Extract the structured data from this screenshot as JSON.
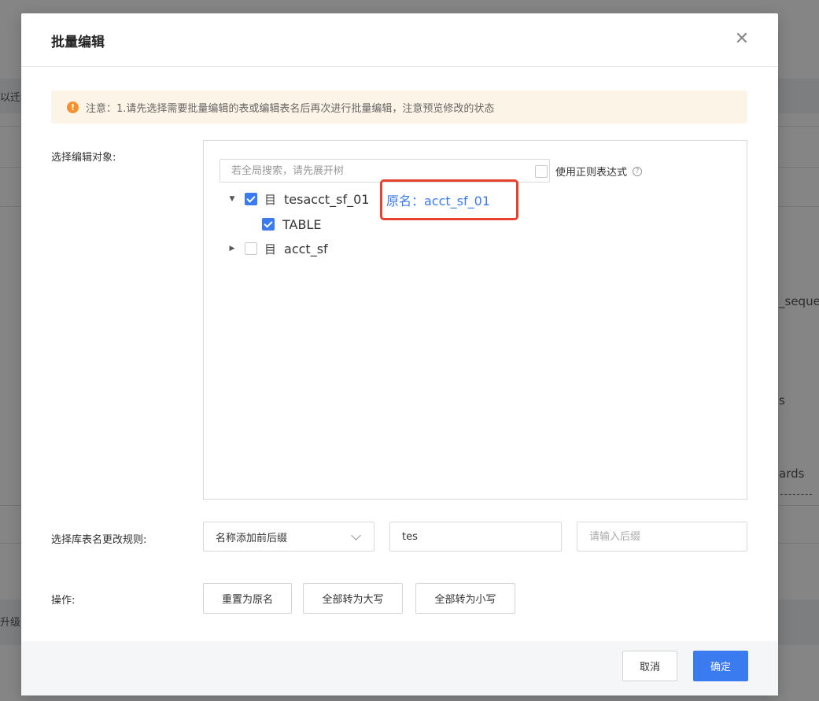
{
  "background": {
    "fragments": [
      "以迁移",
      "_seque",
      "s",
      "ards",
      "升级"
    ]
  },
  "modal": {
    "title": "批量编辑",
    "close_icon": "close-icon",
    "notice": {
      "icon": "warning-icon",
      "icon_glyph": "!",
      "text": "注意：1.请先选择需要批量编辑的表或编辑表名后再次进行批量编辑，注意预览修改的状态"
    },
    "select_target": {
      "label": "选择编辑对象:",
      "search_placeholder": "若全局搜索，请先展开树",
      "regex_label": "使用正则表达式",
      "regex_checked": false,
      "tree": [
        {
          "label": "tesacct_sf_01",
          "expanded": true,
          "checked": true,
          "icon": "database-icon",
          "original_name": "原名：acct_sf_01",
          "children": [
            {
              "label": "TABLE",
              "checked": true
            }
          ]
        },
        {
          "label": "acct_sf",
          "expanded": false,
          "checked": false,
          "icon": "database-icon"
        }
      ]
    },
    "rename_rule": {
      "label": "选择库表名更改规则:",
      "selected": "名称添加前后缀",
      "prefix_value": "tes",
      "suffix_placeholder": "请输入后缀"
    },
    "operations": {
      "label": "操作:",
      "buttons": [
        "重置为原名",
        "全部转为大写",
        "全部转为小写"
      ]
    },
    "footer": {
      "cancel": "取消",
      "confirm": "确定",
      "confirm_color": "#3a7bf0"
    },
    "highlight_color": "#e8412f",
    "warning_color": "#f5902e"
  }
}
